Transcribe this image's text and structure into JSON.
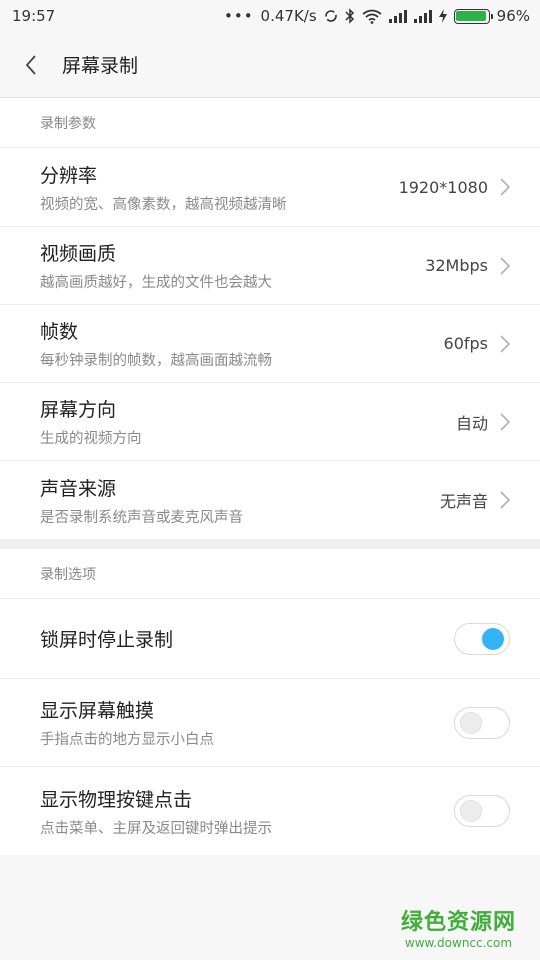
{
  "status": {
    "time": "19:57",
    "dots": "•••",
    "speed": "0.47K/s",
    "battery": "96%",
    "battery_level": 0.96,
    "battery_color": "#2bb34a"
  },
  "header": {
    "title": "屏幕录制"
  },
  "params": {
    "section_title": "录制参数",
    "items": [
      {
        "label": "分辨率",
        "sub": "视频的宽、高像素数，越高视频越清晰",
        "value": "1920*1080"
      },
      {
        "label": "视频画质",
        "sub": "越高画质越好，生成的文件也会越大",
        "value": "32Mbps"
      },
      {
        "label": "帧数",
        "sub": "每秒钟录制的帧数，越高画面越流畅",
        "value": "60fps"
      },
      {
        "label": "屏幕方向",
        "sub": "生成的视频方向",
        "value": "自动"
      },
      {
        "label": "声音来源",
        "sub": "是否录制系统声音或麦克风声音",
        "value": "无声音"
      }
    ]
  },
  "options": {
    "section_title": "录制选项",
    "items": [
      {
        "label": "锁屏时停止录制",
        "on": true
      },
      {
        "label": "显示屏幕触摸",
        "sub": "手指点击的地方显示小白点",
        "on": false
      },
      {
        "label": "显示物理按键点击",
        "sub": "点击菜单、主屏及返回键时弹出提示",
        "on": false
      }
    ]
  },
  "watermark": {
    "cn": "绿色资源网",
    "en": "www.downcc.com"
  },
  "colors": {
    "accent": "#33b5f5",
    "watermark": "#3fae3a"
  }
}
